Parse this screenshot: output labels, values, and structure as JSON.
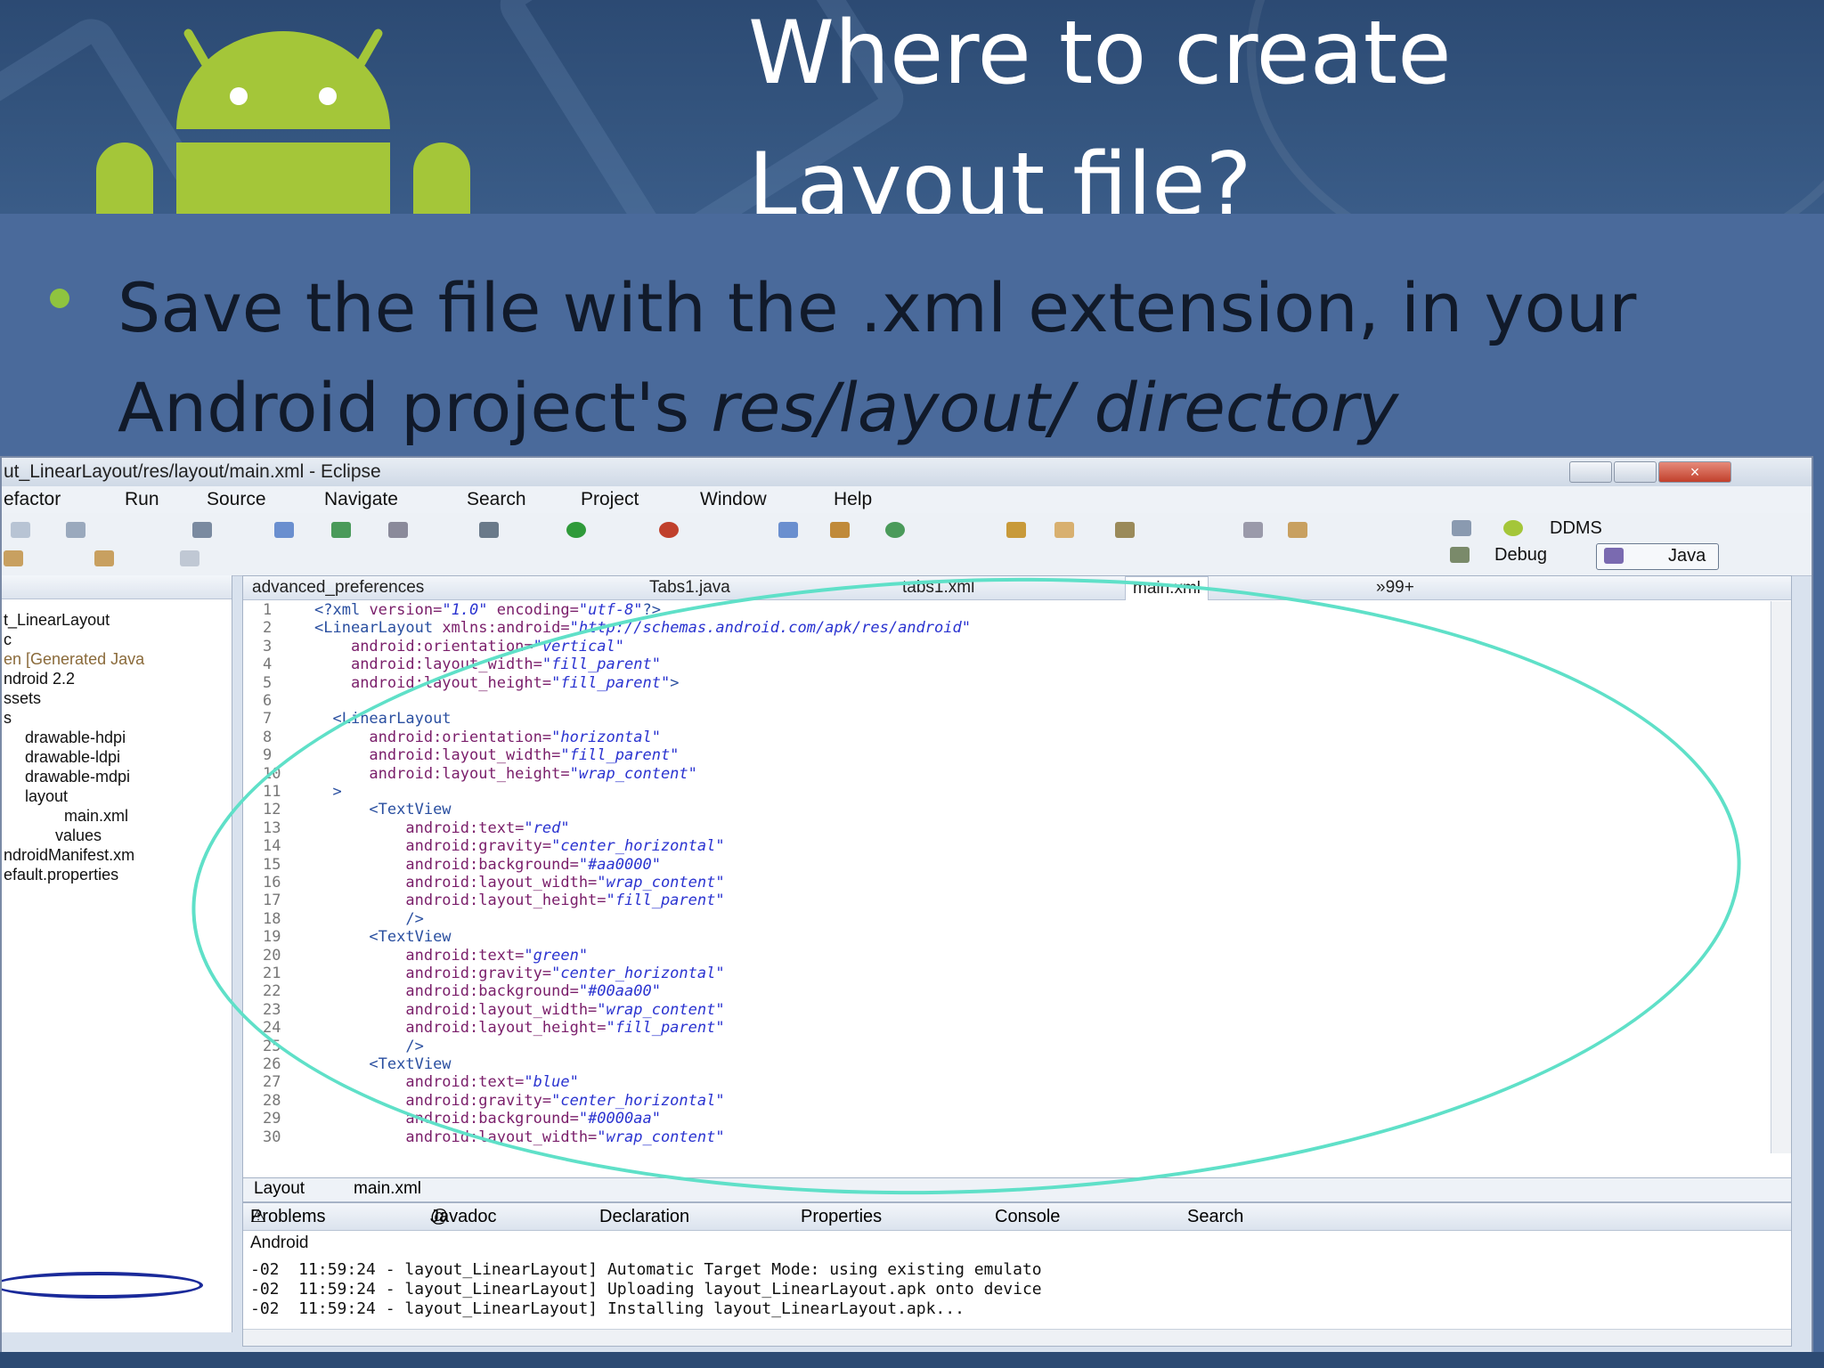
{
  "slide": {
    "title_line1": "Where to create",
    "title_line2": "Layout file?",
    "bullet_line1": "Save the file with the .xml extension, in your",
    "bullet_line2_plain": "Android project's ",
    "bullet_line2_italic": "res/layout/ directory",
    "accent_color": "#8fc43f",
    "logo_icon": "android-robot-icon"
  },
  "eclipse": {
    "window_title": "ut_LinearLayout/res/layout/main.xml - Eclipse",
    "menu": [
      "efactor",
      "Run",
      "Source",
      "Navigate",
      "Search",
      "Project",
      "Window",
      "Help"
    ],
    "perspectives": {
      "ddms": "DDMS",
      "debug": "Debug",
      "java": "Java"
    },
    "tree": [
      "t_LinearLayout",
      "c",
      "en [Generated Java",
      "ndroid 2.2",
      "ssets",
      "s",
      "drawable-hdpi",
      "drawable-ldpi",
      "drawable-mdpi",
      "layout",
      "main.xml",
      "values",
      "ndroidManifest.xm",
      "efault.properties"
    ],
    "editor_tabs": [
      "advanced_preferences",
      "Tabs1.java",
      "tabs1.xml",
      "main.xml",
      "»99+"
    ],
    "code_lines": [
      {
        "n": "1",
        "text": "<?xml version=\"1.0\" encoding=\"utf-8\"?>"
      },
      {
        "n": "2",
        "text": "<LinearLayout xmlns:android=\"http://schemas.android.com/apk/res/android\""
      },
      {
        "n": "3",
        "text": "    android:orientation=\"vertical\""
      },
      {
        "n": "4",
        "text": "    android:layout_width=\"fill_parent\""
      },
      {
        "n": "5",
        "text": "    android:layout_height=\"fill_parent\">"
      },
      {
        "n": "6",
        "text": ""
      },
      {
        "n": "7",
        "text": "  <LinearLayout"
      },
      {
        "n": "8",
        "text": "      android:orientation=\"horizontal\""
      },
      {
        "n": "9",
        "text": "      android:layout_width=\"fill_parent\""
      },
      {
        "n": "10",
        "text": "      android:layout_height=\"wrap_content\""
      },
      {
        "n": "11",
        "text": "  >"
      },
      {
        "n": "12",
        "text": "      <TextView"
      },
      {
        "n": "13",
        "text": "          android:text=\"red\""
      },
      {
        "n": "14",
        "text": "          android:gravity=\"center_horizontal\""
      },
      {
        "n": "15",
        "text": "          android:background=\"#aa0000\""
      },
      {
        "n": "16",
        "text": "          android:layout_width=\"wrap_content\""
      },
      {
        "n": "17",
        "text": "          android:layout_height=\"fill_parent\""
      },
      {
        "n": "18",
        "text": "          />"
      },
      {
        "n": "19",
        "text": "      <TextView"
      },
      {
        "n": "20",
        "text": "          android:text=\"green\""
      },
      {
        "n": "21",
        "text": "          android:gravity=\"center_horizontal\""
      },
      {
        "n": "22",
        "text": "          android:background=\"#00aa00\""
      },
      {
        "n": "23",
        "text": "          android:layout_width=\"wrap_content\""
      },
      {
        "n": "24",
        "text": "          android:layout_height=\"fill_parent\""
      },
      {
        "n": "25",
        "text": "          />"
      },
      {
        "n": "26",
        "text": "      <TextView"
      },
      {
        "n": "27",
        "text": "          android:text=\"blue\""
      },
      {
        "n": "28",
        "text": "          android:gravity=\"center_horizontal\""
      },
      {
        "n": "29",
        "text": "          android:background=\"#0000aa\""
      },
      {
        "n": "30",
        "text": "          android:layout_width=\"wrap_content\""
      }
    ],
    "editor_subtabs": [
      "Layout",
      "main.xml"
    ],
    "bottom_tabs": [
      "Problems",
      "Javadoc",
      "Declaration",
      "Properties",
      "Console",
      "Search"
    ],
    "console_label": "Android",
    "console_lines": [
      "-02  11:59:24 - layout_LinearLayout] Automatic Target Mode: using existing emulato",
      "-02  11:59:24 - layout_LinearLayout] Uploading layout_LinearLayout.apk onto device",
      "-02  11:59:24 - layout_LinearLayout] Installing layout_LinearLayout.apk..."
    ],
    "highlight_color": "#5fe0c8"
  }
}
